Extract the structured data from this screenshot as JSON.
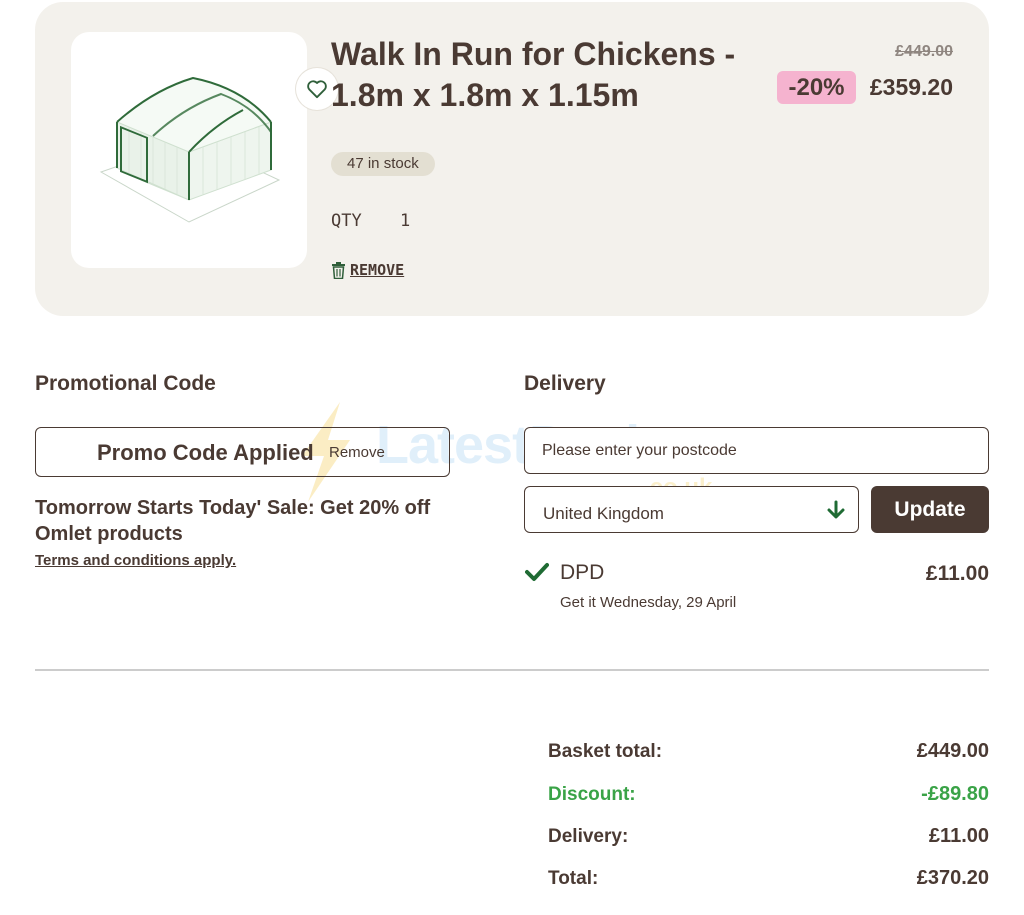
{
  "colors": {
    "brand": "#4a3a33",
    "card_bg": "#f3f1ec",
    "discount_badge": "#f5b3cf",
    "stock_badge": "#e3dfd2",
    "discount_text": "#3aa347",
    "check": "#1f6b34"
  },
  "product": {
    "title": "Walk In Run for Chickens - 1.8m x 1.8m x 1.15m",
    "original_price": "£449.00",
    "discount": "-20%",
    "price": "£359.20",
    "stock": "47 in stock",
    "qty_label": "QTY",
    "qty_value": "1",
    "remove_label": "REMOVE",
    "favourite_icon": "heart-icon",
    "remove_icon": "trash-icon"
  },
  "promo": {
    "heading": "Promotional Code",
    "applied_text": "Promo Code Applied",
    "remove_label": "Remove",
    "sale_text": "Tomorrow Starts Today' Sale: Get 20% off Omlet products",
    "terms": "Terms and conditions apply."
  },
  "delivery": {
    "heading": "Delivery",
    "postcode_placeholder": "Please enter your postcode",
    "country": "United Kingdom",
    "update_label": "Update",
    "method": "DPD",
    "date": "Get it Wednesday, 29 April",
    "price": "£11.00"
  },
  "summary": {
    "basket_label": "Basket total:",
    "basket_value": "£449.00",
    "discount_label": "Discount:",
    "discount_value": "-£89.80",
    "delivery_label": "Delivery:",
    "delivery_value": "£11.00",
    "total_label": "Total:",
    "total_value": "£370.20"
  },
  "watermark": {
    "main": "LatestDeals",
    "sub": ".co.uk"
  }
}
